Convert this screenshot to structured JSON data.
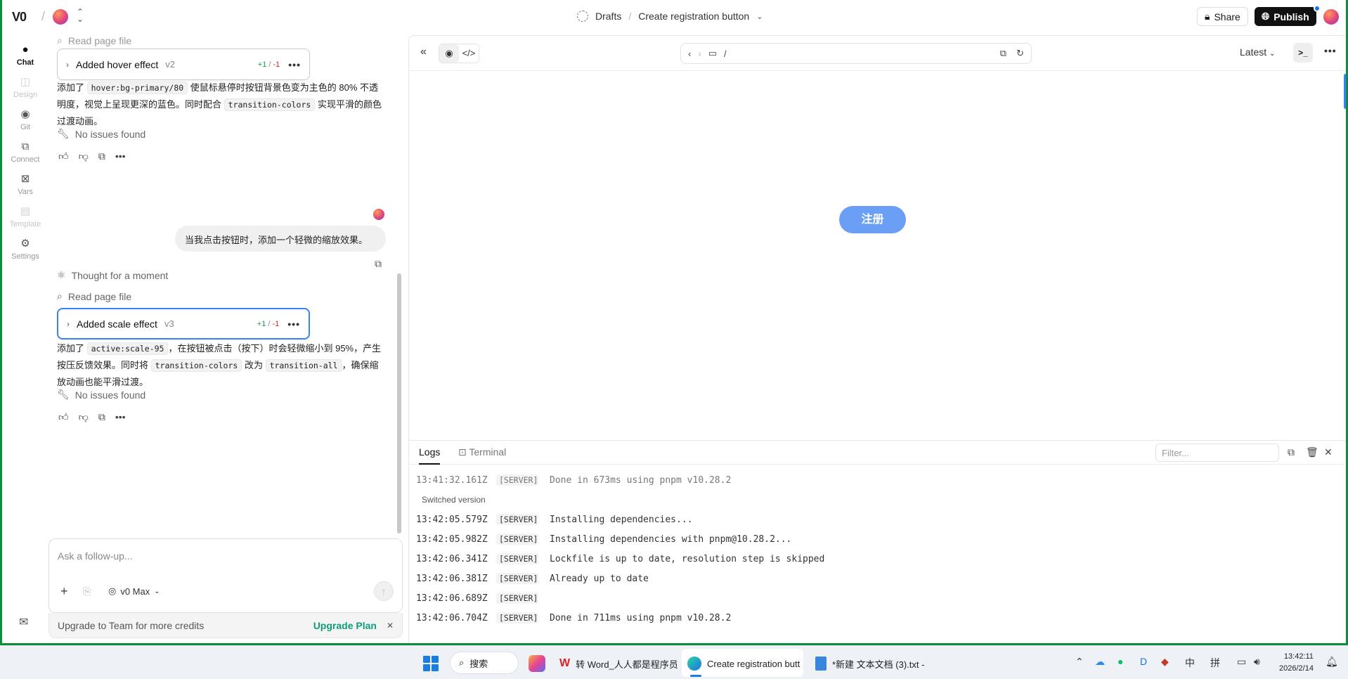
{
  "topbar": {
    "logo": "V0",
    "breadcrumb_drafts": "Drafts",
    "breadcrumb_separator": "/",
    "project_title": "Create registration button",
    "share_label": "Share",
    "publish_label": "Publish"
  },
  "rail": {
    "items": [
      {
        "label": "Chat",
        "icon": "chat-bubble-icon"
      },
      {
        "label": "Design",
        "icon": "design-icon"
      },
      {
        "label": "Git",
        "icon": "github-icon"
      },
      {
        "label": "Connect",
        "icon": "plug-icon"
      },
      {
        "label": "Vars",
        "icon": "variable-icon"
      },
      {
        "label": "Template",
        "icon": "template-icon"
      },
      {
        "label": "Settings",
        "icon": "gear-icon"
      }
    ]
  },
  "chat": {
    "read_page_file_top": "Read page file",
    "card1": {
      "title": "Added hover effect",
      "version": "v2",
      "diff_add": "+1",
      "diff_sep": "/",
      "diff_del": "-1"
    },
    "para1": {
      "p1": "添加了 ",
      "c1": "hover:bg-primary/80",
      "p2": " 使鼠标悬停时按钮背景色变为主色的 80% 不透明度，视觉上呈现更深的蓝色。同时配合 ",
      "c2": "transition-colors",
      "p3": " 实现平滑的颜色过渡动画。"
    },
    "no_issues_1": "No issues found",
    "user_message": "当我点击按钮时，添加一个轻微的缩放效果。",
    "thought": "Thought for a moment",
    "read_page_file": "Read page file",
    "card2": {
      "title": "Added scale effect",
      "version": "v3",
      "diff_add": "+1",
      "diff_sep": "/",
      "diff_del": "-1"
    },
    "para2": {
      "p1": "添加了 ",
      "c1": "active:scale-95",
      "p2": "，在按钮被点击（按下）时会轻微缩小到 95%，产生按压反馈效果。同时将 ",
      "c2": "transition-colors",
      "p3": " 改为 ",
      "c3": "transition-all",
      "p4": "，确保缩放动画也能平滑过渡。"
    },
    "no_issues_2": "No issues found"
  },
  "composer": {
    "placeholder": "Ask a follow-up...",
    "model": "v0 Max",
    "upgrade_text": "Upgrade to Team for more credits",
    "upgrade_link": "Upgrade Plan"
  },
  "preview": {
    "url_path": "/",
    "version_select": "Latest",
    "term_glyph": ">_",
    "button_label": "注册"
  },
  "logs": {
    "tab_logs": "Logs",
    "tab_terminal": "Terminal",
    "filter_placeholder": "Filter...",
    "rows": [
      {
        "ts": "13:41:32.161Z",
        "tag": "[SERVER]",
        "msg": "Done in 673ms using pnpm v10.28.2"
      },
      {
        "ts": "13:42:05.579Z",
        "tag": "[SERVER]",
        "msg": "Installing dependencies..."
      },
      {
        "ts": "13:42:05.982Z",
        "tag": "[SERVER]",
        "msg": "Installing dependencies with pnpm@10.28.2..."
      },
      {
        "ts": "13:42:06.341Z",
        "tag": "[SERVER]",
        "msg": "Lockfile is up to date, resolution step is skipped"
      },
      {
        "ts": "13:42:06.381Z",
        "tag": "[SERVER]",
        "msg": "Already up to date"
      },
      {
        "ts": "13:42:06.689Z",
        "tag": "[SERVER]",
        "msg": ""
      },
      {
        "ts": "13:42:06.704Z",
        "tag": "[SERVER]",
        "msg": "Done in 711ms using pnpm v10.28.2"
      }
    ],
    "switched_version": "Switched version"
  },
  "taskbar": {
    "search_label": "搜索",
    "wps_label": "转 Word_人人都是程序员",
    "edge_label": "Create registration butt",
    "notepad_label": "*新建 文本文档 (3).txt - ",
    "ime_zh": "中",
    "ime_pin": "拼",
    "time": "13:42:11",
    "date": "2026/2/14"
  },
  "colors": {
    "accent_blue": "#3b82f6",
    "button_blue": "#6a9ff5",
    "upgrade_green": "#0f9d7a",
    "diff_add": "#16a34a",
    "diff_del": "#dc2626"
  }
}
